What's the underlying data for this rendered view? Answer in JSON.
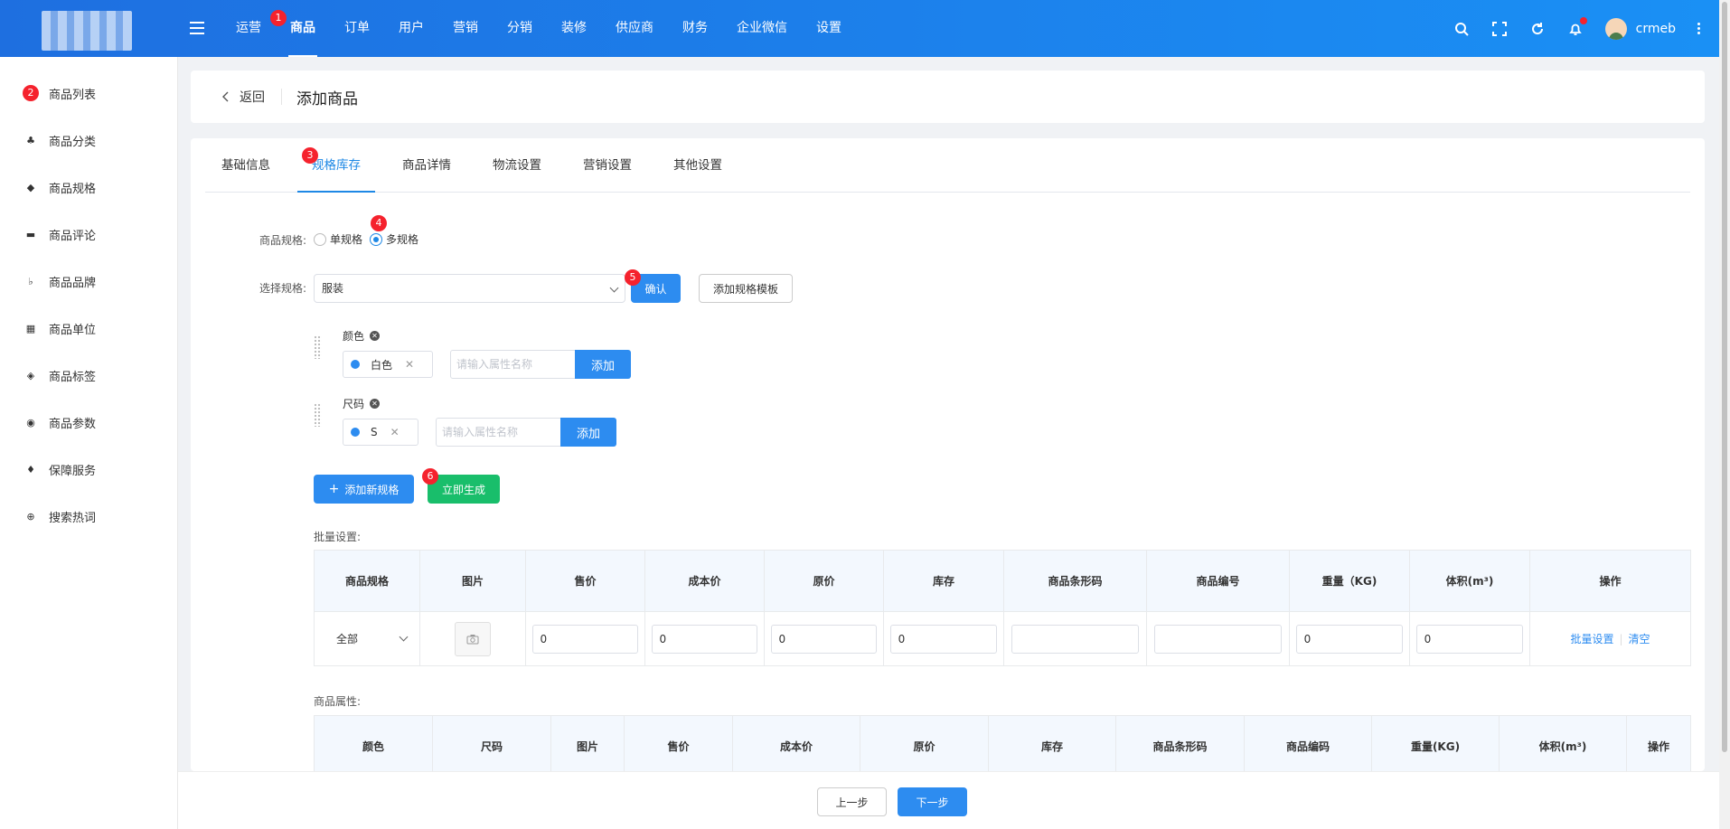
{
  "header": {
    "nav": [
      "运营",
      "商品",
      "订单",
      "用户",
      "营销",
      "分销",
      "装修",
      "供应商",
      "财务",
      "企业微信",
      "设置"
    ],
    "active_nav": "商品",
    "user": "crmeb"
  },
  "sidebar": {
    "items": [
      {
        "label": "商品列表",
        "icon": "list-icon"
      },
      {
        "label": "商品分类",
        "icon": "category-icon"
      },
      {
        "label": "商品规格",
        "icon": "box-icon"
      },
      {
        "label": "商品评论",
        "icon": "comment-icon"
      },
      {
        "label": "商品品牌",
        "icon": "brand-icon"
      },
      {
        "label": "商品单位",
        "icon": "grid-icon"
      },
      {
        "label": "商品标签",
        "icon": "tag-icon"
      },
      {
        "label": "商品参数",
        "icon": "eye-icon"
      },
      {
        "label": "保障服务",
        "icon": "shield-icon"
      },
      {
        "label": "搜索热词",
        "icon": "globe-icon"
      }
    ]
  },
  "badges": [
    "1",
    "2",
    "3",
    "4",
    "5",
    "6"
  ],
  "page_head": {
    "back_label": "返回",
    "title": "添加商品"
  },
  "tabs": [
    "基础信息",
    "规格库存",
    "商品详情",
    "物流设置",
    "营销设置",
    "其他设置"
  ],
  "active_tab": "规格库存",
  "form": {
    "spec_type_label": "商品规格:",
    "single_spec": "单规格",
    "multi_spec": "多规格",
    "select_spec_label": "选择规格:",
    "select_value": "服装",
    "confirm_button": "确认",
    "add_template_button": "添加规格模板"
  },
  "specs": [
    {
      "name": "颜色",
      "tag": "白色",
      "placeholder": "请输入属性名称",
      "add_label": "添加"
    },
    {
      "name": "尺码",
      "tag": "S",
      "placeholder": "请输入属性名称",
      "add_label": "添加"
    }
  ],
  "add_spec_button": "添加新规格",
  "generate_button": "立即生成",
  "batch": {
    "label": "批量设置:",
    "headers": [
      "商品规格",
      "图片",
      "售价",
      "成本价",
      "原价",
      "库存",
      "商品条形码",
      "商品编号",
      "重量（KG)",
      "体积(m³)",
      "操作"
    ],
    "row": {
      "spec": "全部",
      "price": "0",
      "cost": "0",
      "original": "0",
      "stock": "0",
      "barcode": "",
      "code": "",
      "weight": "0",
      "volume": "0"
    },
    "batch_link": "批量设置",
    "clear_link": "清空"
  },
  "attrs": {
    "label": "商品属性:",
    "headers": [
      "颜色",
      "尺码",
      "图片",
      "售价",
      "成本价",
      "原价",
      "库存",
      "商品条形码",
      "商品编码",
      "重量(KG)",
      "体积(m³)",
      "操作"
    ]
  },
  "footer": {
    "prev": "上一步",
    "next": "下一步"
  },
  "colors": {
    "primary": "#2d8cf0",
    "header_start": "#1e6fe0",
    "header_end": "#1a90f5",
    "green": "#19be6b",
    "badge": "#f5222d"
  }
}
